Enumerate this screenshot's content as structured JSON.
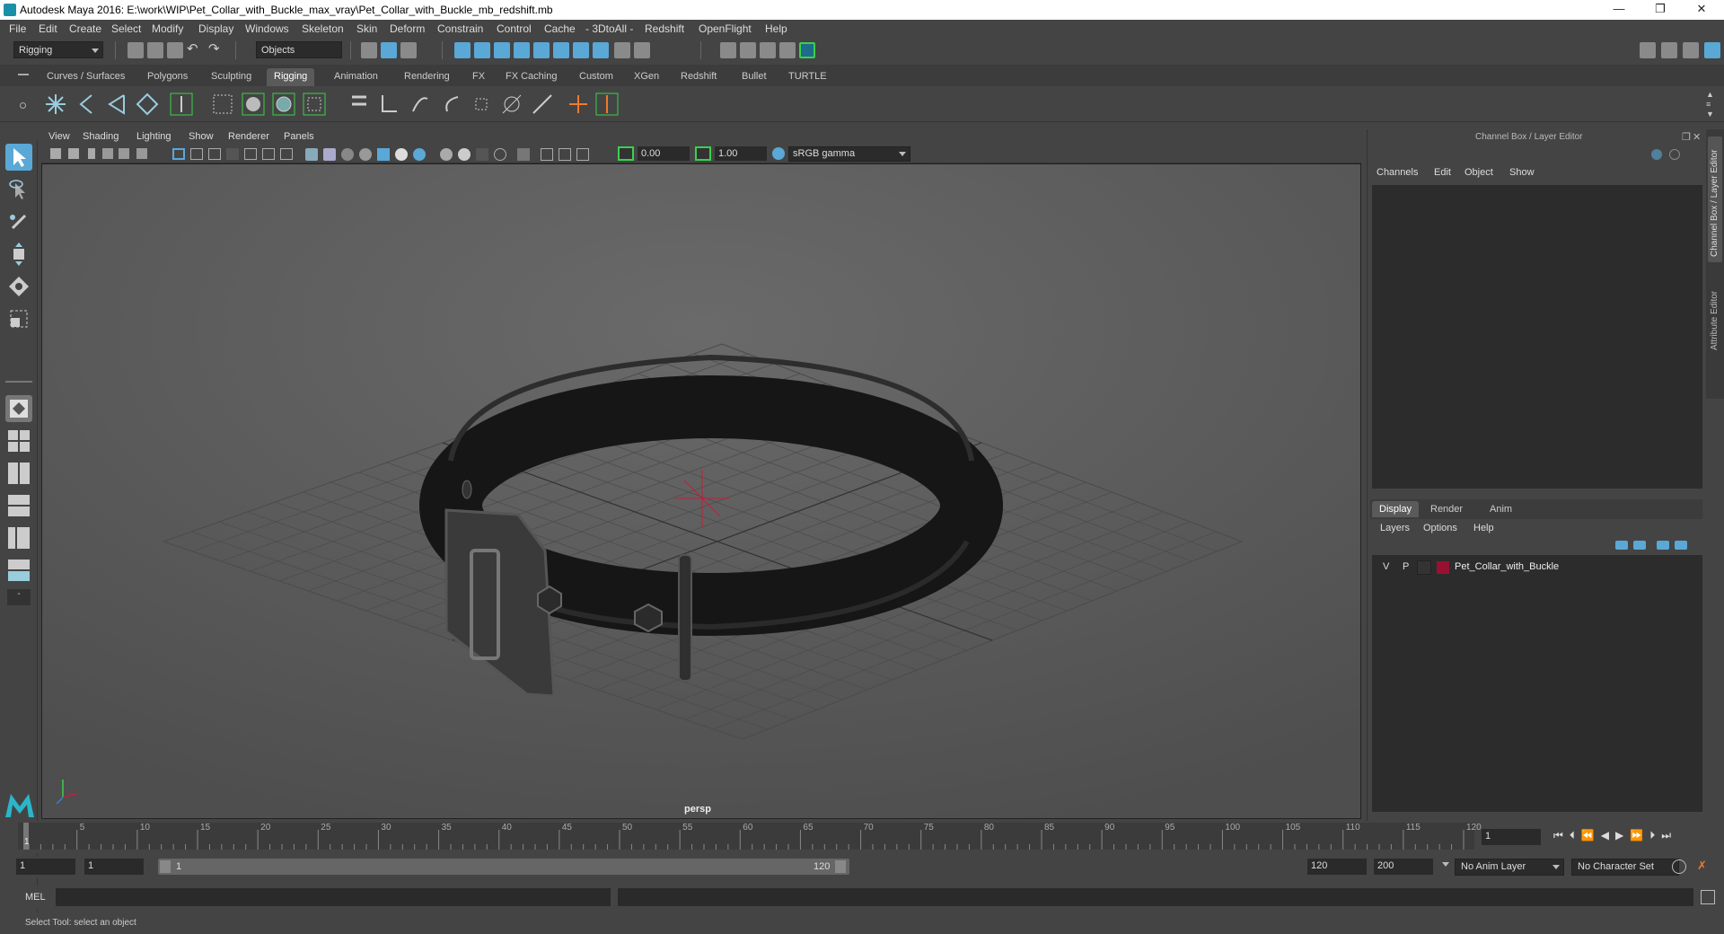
{
  "window": {
    "title": "Autodesk Maya 2016: E:\\work\\WIP\\Pet_Collar_with_Buckle_max_vray\\Pet_Collar_with_Buckle_mb_redshift.mb",
    "minimize": "—",
    "maximize": "❐",
    "close": "✕"
  },
  "menubar": [
    "File",
    "Edit",
    "Create",
    "Select",
    "Modify",
    "Display",
    "Windows",
    "Skeleton",
    "Skin",
    "Deform",
    "Constrain",
    "Control",
    "Cache",
    "- 3DtoAll -",
    "Redshift",
    "OpenFlight",
    "Help"
  ],
  "statusline": {
    "menuset": "Rigging",
    "selection_mode": "Objects"
  },
  "shelf_tabs": [
    "Curves / Surfaces",
    "Polygons",
    "Sculpting",
    "Rigging",
    "Animation",
    "Rendering",
    "FX",
    "FX Caching",
    "Custom",
    "XGen",
    "Redshift",
    "Bullet",
    "TURTLE"
  ],
  "shelf_active": "Rigging",
  "viewport": {
    "menus": [
      "View",
      "Shading",
      "Lighting",
      "Show",
      "Renderer",
      "Panels"
    ],
    "exposure": "0.00",
    "gamma": "1.00",
    "color_space": "sRGB gamma",
    "camera_label": "persp"
  },
  "channel_box": {
    "title": "Channel Box / Layer Editor",
    "menus": [
      "Channels",
      "Edit",
      "Object",
      "Show"
    ],
    "side_tabs": [
      "Channel Box / Layer Editor",
      "Attribute Editor"
    ]
  },
  "layer_editor": {
    "tabs": [
      "Display",
      "Render",
      "Anim"
    ],
    "active_tab": "Display",
    "menus": [
      "Layers",
      "Options",
      "Help"
    ],
    "layers": [
      {
        "visible": "V",
        "playback": "P",
        "name": "Pet_Collar_with_Buckle",
        "color": "#9a1030"
      }
    ]
  },
  "timeline": {
    "ticks": [
      "5",
      "10",
      "15",
      "20",
      "25",
      "30",
      "35",
      "40",
      "45",
      "50",
      "55",
      "60",
      "65",
      "70",
      "75",
      "80",
      "85",
      "90",
      "95",
      "100",
      "105",
      "110",
      "115",
      "120"
    ],
    "first_tick": "1",
    "current_frame": "1",
    "range_start": "1",
    "range_start_inner": "1",
    "slider_start": "1",
    "slider_end": "120",
    "range_end": "120",
    "anim_end": "200",
    "anim_layer": "No Anim Layer",
    "character_set": "No Character Set"
  },
  "command_line": {
    "label": "MEL"
  },
  "help_line": "Select Tool: select an object",
  "colors": {
    "bg": "#444444",
    "viewport_bg": "#5f5f5f",
    "accent_green": "#3ad14a",
    "accent_blue": "#5aa8d6",
    "origin_red": "#c0203a"
  }
}
